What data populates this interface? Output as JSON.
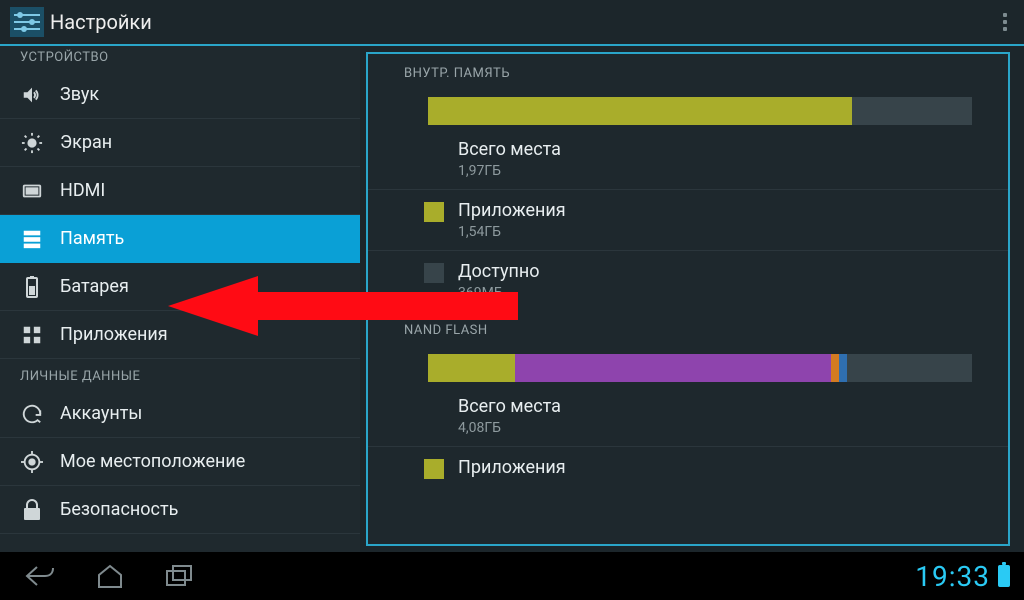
{
  "header": {
    "title": "Настройки"
  },
  "sidebar": {
    "sections": [
      {
        "label": "УСТРОЙСТВО",
        "items": [
          {
            "icon": "volume-icon",
            "label": "Звук",
            "selected": false
          },
          {
            "icon": "brightness-icon",
            "label": "Экран",
            "selected": false
          },
          {
            "icon": "hdmi-icon",
            "label": "HDMI",
            "selected": false
          },
          {
            "icon": "storage-icon",
            "label": "Память",
            "selected": true
          },
          {
            "icon": "battery-icon",
            "label": "Батарея",
            "selected": false
          },
          {
            "icon": "apps-icon",
            "label": "Приложения",
            "selected": false
          }
        ]
      },
      {
        "label": "ЛИЧНЫЕ ДАННЫЕ",
        "items": [
          {
            "icon": "sync-icon",
            "label": "Аккаунты",
            "selected": false
          },
          {
            "icon": "location-icon",
            "label": "Мое местоположение",
            "selected": false
          },
          {
            "icon": "lock-icon",
            "label": "Безопасность",
            "selected": false
          }
        ]
      }
    ]
  },
  "detail": {
    "sections": [
      {
        "title": "ВНУТР. ПАМЯТЬ",
        "bar": [
          {
            "color": "#a9ad2b",
            "percent": 78
          },
          {
            "color": "#37444a",
            "percent": 22
          }
        ],
        "rows": [
          {
            "swatch": null,
            "title": "Всего места",
            "sub": "1,97ГБ"
          },
          {
            "swatch": "#a9ad2b",
            "title": "Приложения",
            "sub": "1,54ГБ"
          },
          {
            "swatch": "#37444a",
            "title": "Доступно",
            "sub": "369МБ"
          }
        ]
      },
      {
        "title": "NAND FLASH",
        "bar": [
          {
            "color": "#a9ad2b",
            "percent": 16
          },
          {
            "color": "#8e44ad",
            "percent": 58
          },
          {
            "color": "#d37b22",
            "percent": 1.5
          },
          {
            "color": "#2f6fb0",
            "percent": 1.5
          },
          {
            "color": "#37444a",
            "percent": 23
          }
        ],
        "rows": [
          {
            "swatch": null,
            "title": "Всего места",
            "sub": "4,08ГБ"
          },
          {
            "swatch": "#a9ad2b",
            "title": "Приложения",
            "sub": ""
          }
        ]
      }
    ]
  },
  "navbar": {
    "time": "19:33"
  }
}
